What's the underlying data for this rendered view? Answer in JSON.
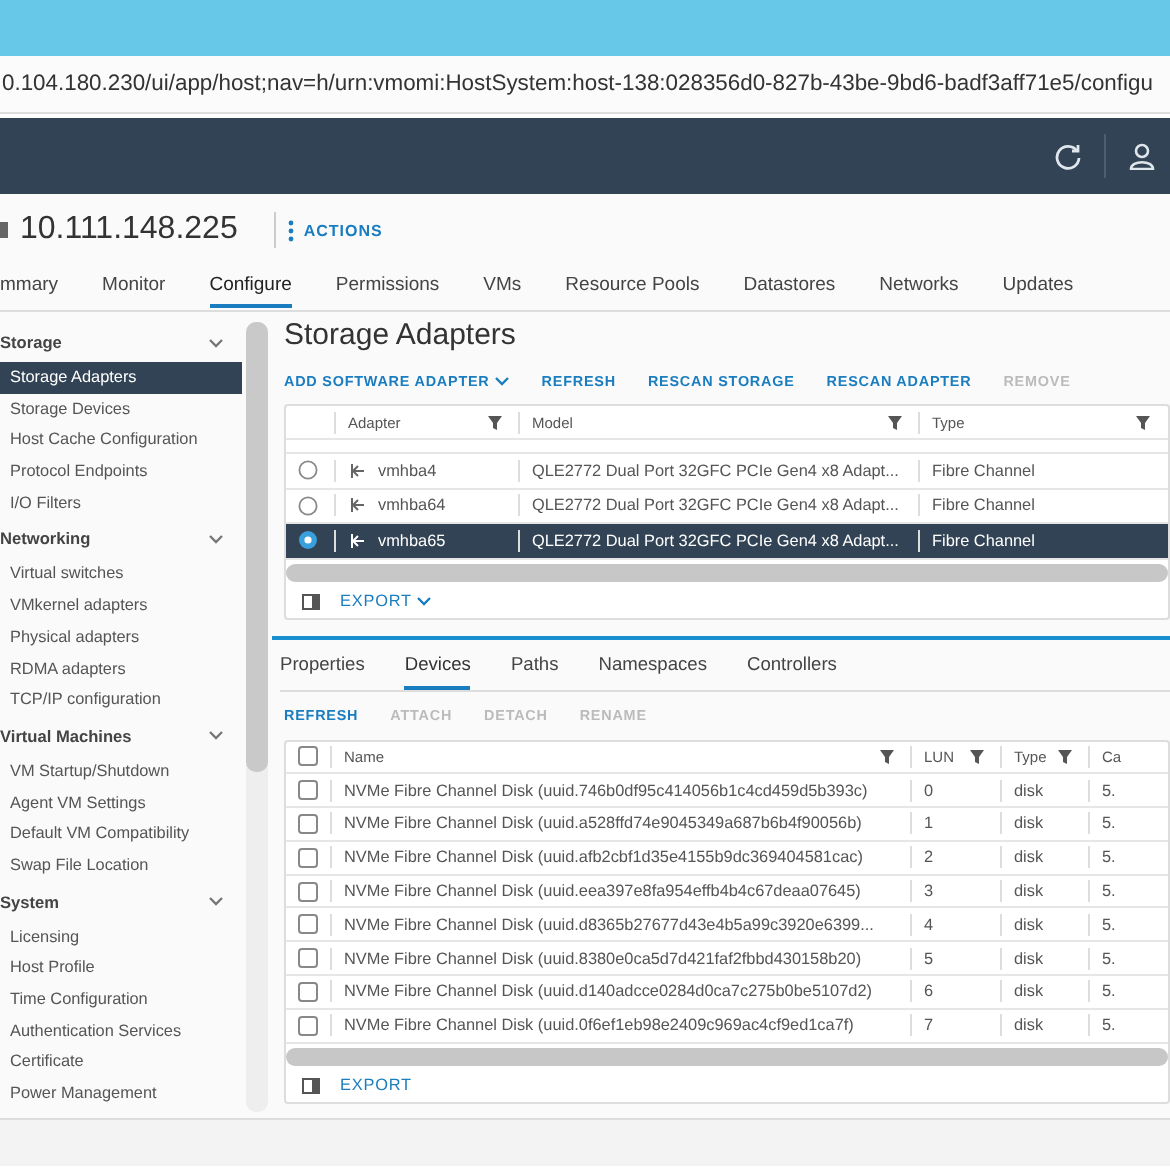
{
  "browser": {
    "address": "0.104.180.230/ui/app/host;nav=h/urn:vmomi:HostSystem:host-138:028356d0-827b-43be-9bd6-badf3aff71e5/configu"
  },
  "host": {
    "name": "10.111.148.225",
    "actions": "ACTIONS"
  },
  "tabs": [
    {
      "label": "mmary",
      "selected": false
    },
    {
      "label": "Monitor",
      "selected": false
    },
    {
      "label": "Configure",
      "selected": true
    },
    {
      "label": "Permissions",
      "selected": false
    },
    {
      "label": "VMs",
      "selected": false
    },
    {
      "label": "Resource Pools",
      "selected": false
    },
    {
      "label": "Datastores",
      "selected": false
    },
    {
      "label": "Networks",
      "selected": false
    },
    {
      "label": "Updates",
      "selected": false
    }
  ],
  "sidebar": {
    "sections": [
      {
        "title": "Storage",
        "expanded": true,
        "items": [
          {
            "label": "Storage Adapters",
            "selected": true
          },
          {
            "label": "Storage Devices",
            "selected": false
          },
          {
            "label": "Host Cache Configuration",
            "selected": false
          },
          {
            "label": "Protocol Endpoints",
            "selected": false
          },
          {
            "label": "I/O Filters",
            "selected": false
          }
        ]
      },
      {
        "title": "Networking",
        "expanded": true,
        "items": [
          {
            "label": "Virtual switches",
            "selected": false
          },
          {
            "label": "VMkernel adapters",
            "selected": false
          },
          {
            "label": "Physical adapters",
            "selected": false
          },
          {
            "label": "RDMA adapters",
            "selected": false
          },
          {
            "label": "TCP/IP configuration",
            "selected": false
          }
        ]
      },
      {
        "title": "Virtual Machines",
        "expanded": true,
        "items": [
          {
            "label": "VM Startup/Shutdown",
            "selected": false
          },
          {
            "label": "Agent VM Settings",
            "selected": false
          },
          {
            "label": "Default VM Compatibility",
            "selected": false
          },
          {
            "label": "Swap File Location",
            "selected": false
          }
        ]
      },
      {
        "title": "System",
        "expanded": true,
        "items": [
          {
            "label": "Licensing",
            "selected": false
          },
          {
            "label": "Host Profile",
            "selected": false
          },
          {
            "label": "Time Configuration",
            "selected": false
          },
          {
            "label": "Authentication Services",
            "selected": false
          },
          {
            "label": "Certificate",
            "selected": false
          },
          {
            "label": "Power Management",
            "selected": false
          }
        ]
      }
    ]
  },
  "adapters": {
    "title": "Storage Adapters",
    "toolbar": [
      {
        "label": "ADD SOFTWARE ADAPTER",
        "disabled": false,
        "has_menu": true
      },
      {
        "label": "REFRESH",
        "disabled": false,
        "has_menu": false
      },
      {
        "label": "RESCAN STORAGE",
        "disabled": false,
        "has_menu": false
      },
      {
        "label": "RESCAN ADAPTER",
        "disabled": false,
        "has_menu": false
      },
      {
        "label": "REMOVE",
        "disabled": true,
        "has_menu": false
      }
    ],
    "columns": [
      "Adapter",
      "Model",
      "Type"
    ],
    "rows": [
      {
        "adapter": "vmhba4",
        "model": "QLE2772 Dual Port 32GFC PCIe Gen4 x8 Adapt...",
        "type": "Fibre Channel",
        "selected": false
      },
      {
        "adapter": "vmhba64",
        "model": "QLE2772 Dual Port 32GFC PCIe Gen4 x8 Adapt...",
        "type": "Fibre Channel",
        "selected": false
      },
      {
        "adapter": "vmhba65",
        "model": "QLE2772 Dual Port 32GFC PCIe Gen4 x8 Adapt...",
        "type": "Fibre Channel",
        "selected": true
      }
    ],
    "export": "EXPORT"
  },
  "details": {
    "tabs": [
      {
        "label": "Properties",
        "selected": false
      },
      {
        "label": "Devices",
        "selected": true
      },
      {
        "label": "Paths",
        "selected": false
      },
      {
        "label": "Namespaces",
        "selected": false
      },
      {
        "label": "Controllers",
        "selected": false
      }
    ],
    "toolbar": [
      {
        "label": "REFRESH",
        "disabled": false
      },
      {
        "label": "ATTACH",
        "disabled": true
      },
      {
        "label": "DETACH",
        "disabled": true
      },
      {
        "label": "RENAME",
        "disabled": true
      }
    ],
    "select_all_checked": false,
    "columns": [
      "Name",
      "LUN",
      "Type",
      "Ca"
    ],
    "rows": [
      {
        "name": "NVMe Fibre Channel Disk (uuid.746b0df95c414056b1c4cd459d5b393c)",
        "lun": "0",
        "type": "disk",
        "column_4": "5.",
        "checked": false
      },
      {
        "name": "NVMe Fibre Channel Disk (uuid.a528ffd74e9045349a687b6b4f90056b)",
        "lun": "1",
        "type": "disk",
        "column_4": "5.",
        "checked": false
      },
      {
        "name": "NVMe Fibre Channel Disk (uuid.afb2cbf1d35e4155b9dc369404581cac)",
        "lun": "2",
        "type": "disk",
        "column_4": "5.",
        "checked": false
      },
      {
        "name": "NVMe Fibre Channel Disk (uuid.eea397e8fa954effb4b4c67deaa07645)",
        "lun": "3",
        "type": "disk",
        "column_4": "5.",
        "checked": false
      },
      {
        "name": "NVMe Fibre Channel Disk (uuid.d8365b27677d43e4b5a99c3920e6399...",
        "lun": "4",
        "type": "disk",
        "column_4": "5.",
        "checked": false
      },
      {
        "name": "NVMe Fibre Channel Disk (uuid.8380e0ca5d7d421faf2fbbd430158b20)",
        "lun": "5",
        "type": "disk",
        "column_4": "5.",
        "checked": false
      },
      {
        "name": "NVMe Fibre Channel Disk (uuid.d140adcce0284d0ca7c275b0be5107d2)",
        "lun": "6",
        "type": "disk",
        "column_4": "5.",
        "checked": false
      },
      {
        "name": "NVMe Fibre Channel Disk (uuid.0f6ef1eb98e2409c969ac4cf9ed1ca7f)",
        "lun": "7",
        "type": "disk",
        "column_4": "5.",
        "checked": false
      }
    ],
    "export": "EXPORT"
  }
}
